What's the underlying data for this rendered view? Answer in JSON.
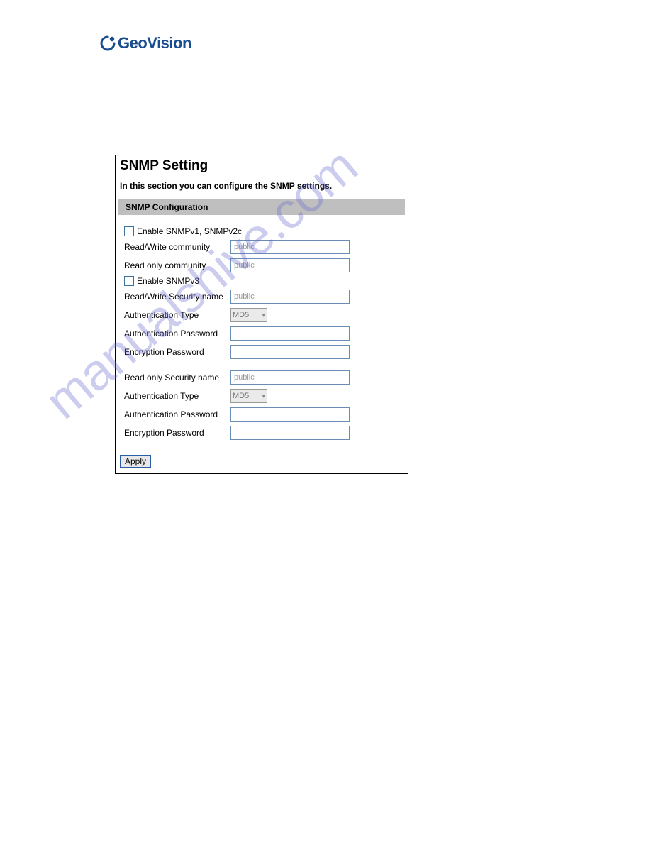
{
  "logo": {
    "text": "GeoVision"
  },
  "panel": {
    "title": "SNMP Setting",
    "subtitle": "In this section you can configure the SNMP settings.",
    "section_header": "SNMP Configuration",
    "enable_v1v2c_label": "Enable SNMPv1, SNMPv2c",
    "rw_community_label": "Read/Write community",
    "rw_community_value": "public",
    "ro_community_label": "Read only community",
    "ro_community_value": "public",
    "enable_v3_label": "Enable SNMPv3",
    "rw_secname_label": "Read/Write Security name",
    "rw_secname_value": "public",
    "rw_authtype_label": "Authentication Type",
    "rw_authtype_value": "MD5",
    "rw_authpwd_label": "Authentication Password",
    "rw_authpwd_value": "",
    "rw_encpwd_label": "Encryption Password",
    "rw_encpwd_value": "",
    "ro_secname_label": "Read only Security name",
    "ro_secname_value": "public",
    "ro_authtype_label": "Authentication Type",
    "ro_authtype_value": "MD5",
    "ro_authpwd_label": "Authentication Password",
    "ro_authpwd_value": "",
    "ro_encpwd_label": "Encryption Password",
    "ro_encpwd_value": "",
    "apply_label": "Apply"
  },
  "watermark": "manualshive.com"
}
